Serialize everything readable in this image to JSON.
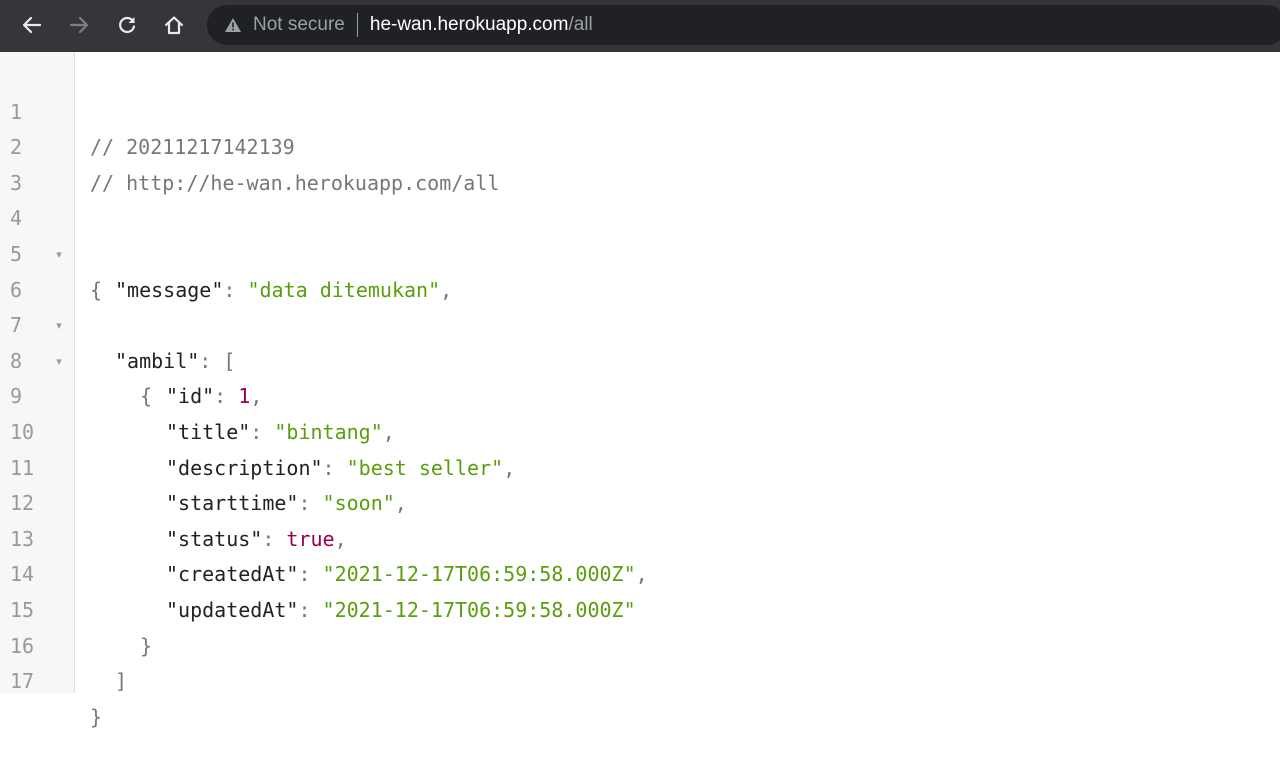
{
  "browser": {
    "security_label": "Not secure",
    "url_host": "he-wan.herokuapp.com",
    "url_path": "/all",
    "icons": {
      "back": "arrow-left-icon",
      "forward": "arrow-right-icon",
      "reload": "reload-icon",
      "home": "home-icon",
      "security": "warning-triangle-icon"
    },
    "colors": {
      "toolbar": "#35363a",
      "omnibox": "#202124",
      "string": "#5a9e0f",
      "number": "#990055",
      "comment": "#777777"
    }
  },
  "json_view": {
    "lines": [
      {
        "n": "1",
        "comment": "// 20211217142139"
      },
      {
        "n": "2",
        "comment": "// http://he-wan.herokuapp.com/all"
      },
      {
        "n": "3"
      },
      {
        "n": "4",
        "open": "{"
      },
      {
        "n": "5",
        "key": "\"message\"",
        "value": "\"data ditemukan\""
      },
      {
        "n": "6",
        "key": "\"ambil\"",
        "open": "["
      },
      {
        "n": "7",
        "open": "{"
      },
      {
        "n": "8",
        "key": "\"id\"",
        "value": "1"
      },
      {
        "n": "9",
        "key": "\"title\"",
        "value": "\"bintang\""
      },
      {
        "n": "10",
        "key": "\"description\"",
        "value": "\"best seller\""
      },
      {
        "n": "11",
        "key": "\"starttime\"",
        "value": "\"soon\""
      },
      {
        "n": "12",
        "key": "\"status\"",
        "value": "true"
      },
      {
        "n": "13",
        "key": "\"createdAt\"",
        "value": "\"2021-12-17T06:59:58.000Z\""
      },
      {
        "n": "14",
        "key": "\"updatedAt\"",
        "value": "\"2021-12-17T06:59:58.000Z\""
      },
      {
        "n": "15",
        "close": "}"
      },
      {
        "n": "16",
        "close": "]"
      },
      {
        "n": "17",
        "close": "}"
      }
    ],
    "punct": {
      "colon": ": ",
      "comma": ",",
      "fold_marker": "▾"
    }
  }
}
